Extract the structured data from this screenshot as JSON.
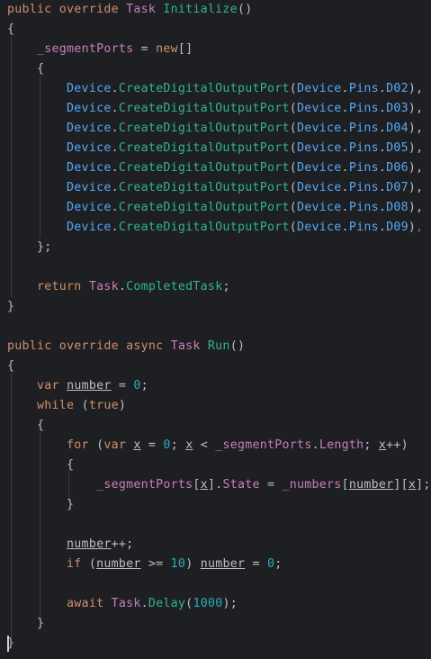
{
  "editor": {
    "lines": [
      [
        {
          "c": "k",
          "t": "public override "
        },
        {
          "c": "t",
          "t": "Task "
        },
        {
          "c": "grn",
          "t": "Initialize"
        },
        {
          "c": "p",
          "t": "()"
        }
      ],
      [
        {
          "c": "p",
          "t": "{"
        }
      ],
      [
        {
          "c": "p",
          "t": "    "
        },
        {
          "c": "f",
          "t": "_segmentPorts"
        },
        {
          "c": "p",
          "t": " = "
        },
        {
          "c": "k",
          "t": "new"
        },
        {
          "c": "p",
          "t": "[]"
        }
      ],
      [
        {
          "c": "p",
          "t": "    {"
        }
      ],
      [
        {
          "c": "p",
          "t": "        "
        },
        {
          "c": "dev",
          "t": "Device"
        },
        {
          "c": "p",
          "t": "."
        },
        {
          "c": "grn",
          "t": "CreateDigitalOutputPort"
        },
        {
          "c": "p",
          "t": "("
        },
        {
          "c": "dev",
          "t": "Device"
        },
        {
          "c": "p",
          "t": "."
        },
        {
          "c": "dev",
          "t": "Pins"
        },
        {
          "c": "p",
          "t": "."
        },
        {
          "c": "dev",
          "t": "D02"
        },
        {
          "c": "p",
          "t": "),"
        }
      ],
      [
        {
          "c": "p",
          "t": "        "
        },
        {
          "c": "dev",
          "t": "Device"
        },
        {
          "c": "p",
          "t": "."
        },
        {
          "c": "grn",
          "t": "CreateDigitalOutputPort"
        },
        {
          "c": "p",
          "t": "("
        },
        {
          "c": "dev",
          "t": "Device"
        },
        {
          "c": "p",
          "t": "."
        },
        {
          "c": "dev",
          "t": "Pins"
        },
        {
          "c": "p",
          "t": "."
        },
        {
          "c": "dev",
          "t": "D03"
        },
        {
          "c": "p",
          "t": "),"
        }
      ],
      [
        {
          "c": "p",
          "t": "        "
        },
        {
          "c": "dev",
          "t": "Device"
        },
        {
          "c": "p",
          "t": "."
        },
        {
          "c": "grn",
          "t": "CreateDigitalOutputPort"
        },
        {
          "c": "p",
          "t": "("
        },
        {
          "c": "dev",
          "t": "Device"
        },
        {
          "c": "p",
          "t": "."
        },
        {
          "c": "dev",
          "t": "Pins"
        },
        {
          "c": "p",
          "t": "."
        },
        {
          "c": "dev",
          "t": "D04"
        },
        {
          "c": "p",
          "t": "),"
        }
      ],
      [
        {
          "c": "p",
          "t": "        "
        },
        {
          "c": "dev",
          "t": "Device"
        },
        {
          "c": "p",
          "t": "."
        },
        {
          "c": "grn",
          "t": "CreateDigitalOutputPort"
        },
        {
          "c": "p",
          "t": "("
        },
        {
          "c": "dev",
          "t": "Device"
        },
        {
          "c": "p",
          "t": "."
        },
        {
          "c": "dev",
          "t": "Pins"
        },
        {
          "c": "p",
          "t": "."
        },
        {
          "c": "dev",
          "t": "D05"
        },
        {
          "c": "p",
          "t": "),"
        }
      ],
      [
        {
          "c": "p",
          "t": "        "
        },
        {
          "c": "dev",
          "t": "Device"
        },
        {
          "c": "p",
          "t": "."
        },
        {
          "c": "grn",
          "t": "CreateDigitalOutputPort"
        },
        {
          "c": "p",
          "t": "("
        },
        {
          "c": "dev",
          "t": "Device"
        },
        {
          "c": "p",
          "t": "."
        },
        {
          "c": "dev",
          "t": "Pins"
        },
        {
          "c": "p",
          "t": "."
        },
        {
          "c": "dev",
          "t": "D06"
        },
        {
          "c": "p",
          "t": "),"
        }
      ],
      [
        {
          "c": "p",
          "t": "        "
        },
        {
          "c": "dev",
          "t": "Device"
        },
        {
          "c": "p",
          "t": "."
        },
        {
          "c": "grn",
          "t": "CreateDigitalOutputPort"
        },
        {
          "c": "p",
          "t": "("
        },
        {
          "c": "dev",
          "t": "Device"
        },
        {
          "c": "p",
          "t": "."
        },
        {
          "c": "dev",
          "t": "Pins"
        },
        {
          "c": "p",
          "t": "."
        },
        {
          "c": "dev",
          "t": "D07"
        },
        {
          "c": "p",
          "t": "),"
        }
      ],
      [
        {
          "c": "p",
          "t": "        "
        },
        {
          "c": "dev",
          "t": "Device"
        },
        {
          "c": "p",
          "t": "."
        },
        {
          "c": "grn",
          "t": "CreateDigitalOutputPort"
        },
        {
          "c": "p",
          "t": "("
        },
        {
          "c": "dev",
          "t": "Device"
        },
        {
          "c": "p",
          "t": "."
        },
        {
          "c": "dev",
          "t": "Pins"
        },
        {
          "c": "p",
          "t": "."
        },
        {
          "c": "dev",
          "t": "D08"
        },
        {
          "c": "p",
          "t": "),"
        }
      ],
      [
        {
          "c": "p",
          "t": "        "
        },
        {
          "c": "dev",
          "t": "Device"
        },
        {
          "c": "p",
          "t": "."
        },
        {
          "c": "grn",
          "t": "CreateDigitalOutputPort"
        },
        {
          "c": "p",
          "t": "("
        },
        {
          "c": "dev",
          "t": "Device"
        },
        {
          "c": "p",
          "t": "."
        },
        {
          "c": "dev",
          "t": "Pins"
        },
        {
          "c": "p",
          "t": "."
        },
        {
          "c": "dev",
          "t": "D09"
        },
        {
          "c": "p",
          "t": ")"
        },
        {
          "c": "dim",
          "t": ","
        }
      ],
      [
        {
          "c": "p",
          "t": "    };"
        }
      ],
      [],
      [
        {
          "c": "p",
          "t": "    "
        },
        {
          "c": "k",
          "t": "return "
        },
        {
          "c": "t",
          "t": "Task"
        },
        {
          "c": "p",
          "t": "."
        },
        {
          "c": "grn",
          "t": "CompletedTask"
        },
        {
          "c": "p",
          "t": ";"
        }
      ],
      [
        {
          "c": "p",
          "t": "}"
        }
      ],
      [],
      [
        {
          "c": "k",
          "t": "public override async "
        },
        {
          "c": "t",
          "t": "Task "
        },
        {
          "c": "grn",
          "t": "Run"
        },
        {
          "c": "p",
          "t": "()"
        }
      ],
      [
        {
          "c": "p",
          "t": "{"
        }
      ],
      [
        {
          "c": "p",
          "t": "    "
        },
        {
          "c": "k",
          "t": "var "
        },
        {
          "c": "v",
          "t": "number"
        },
        {
          "c": "p",
          "t": " = "
        },
        {
          "c": "n",
          "t": "0"
        },
        {
          "c": "p",
          "t": ";"
        }
      ],
      [
        {
          "c": "p",
          "t": "    "
        },
        {
          "c": "k",
          "t": "while "
        },
        {
          "c": "p",
          "t": "("
        },
        {
          "c": "k",
          "t": "true"
        },
        {
          "c": "p",
          "t": ")"
        }
      ],
      [
        {
          "c": "p",
          "t": "    {"
        }
      ],
      [
        {
          "c": "p",
          "t": "        "
        },
        {
          "c": "k",
          "t": "for "
        },
        {
          "c": "p",
          "t": "("
        },
        {
          "c": "k",
          "t": "var "
        },
        {
          "c": "v",
          "t": "x"
        },
        {
          "c": "p",
          "t": " = "
        },
        {
          "c": "n",
          "t": "0"
        },
        {
          "c": "p",
          "t": "; "
        },
        {
          "c": "v",
          "t": "x"
        },
        {
          "c": "p",
          "t": " < "
        },
        {
          "c": "f",
          "t": "_segmentPorts"
        },
        {
          "c": "p",
          "t": "."
        },
        {
          "c": "pr",
          "t": "Length"
        },
        {
          "c": "p",
          "t": "; "
        },
        {
          "c": "v",
          "t": "x"
        },
        {
          "c": "p",
          "t": "++)"
        }
      ],
      [
        {
          "c": "p",
          "t": "        {"
        }
      ],
      [
        {
          "c": "p",
          "t": "            "
        },
        {
          "c": "f",
          "t": "_segmentPorts"
        },
        {
          "c": "p",
          "t": "["
        },
        {
          "c": "v",
          "t": "x"
        },
        {
          "c": "p",
          "t": "]."
        },
        {
          "c": "pr",
          "t": "State"
        },
        {
          "c": "p",
          "t": " = "
        },
        {
          "c": "f",
          "t": "_numbers"
        },
        {
          "c": "p",
          "t": "["
        },
        {
          "c": "v",
          "t": "number"
        },
        {
          "c": "p",
          "t": "]["
        },
        {
          "c": "v",
          "t": "x"
        },
        {
          "c": "p",
          "t": "];"
        }
      ],
      [
        {
          "c": "p",
          "t": "        }"
        }
      ],
      [],
      [
        {
          "c": "p",
          "t": "        "
        },
        {
          "c": "v",
          "t": "number"
        },
        {
          "c": "p",
          "t": "++;"
        }
      ],
      [
        {
          "c": "p",
          "t": "        "
        },
        {
          "c": "k",
          "t": "if "
        },
        {
          "c": "p",
          "t": "("
        },
        {
          "c": "v",
          "t": "number"
        },
        {
          "c": "p",
          "t": " >= "
        },
        {
          "c": "n",
          "t": "10"
        },
        {
          "c": "p",
          "t": ") "
        },
        {
          "c": "v",
          "t": "number"
        },
        {
          "c": "p",
          "t": " = "
        },
        {
          "c": "n",
          "t": "0"
        },
        {
          "c": "p",
          "t": ";"
        }
      ],
      [],
      [
        {
          "c": "p",
          "t": "        "
        },
        {
          "c": "k",
          "t": "await "
        },
        {
          "c": "t",
          "t": "Task"
        },
        {
          "c": "p",
          "t": "."
        },
        {
          "c": "grn",
          "t": "Delay"
        },
        {
          "c": "p",
          "t": "("
        },
        {
          "c": "n",
          "t": "1000"
        },
        {
          "c": "p",
          "t": ");"
        }
      ],
      [
        {
          "c": "p",
          "t": "    }"
        }
      ],
      [
        {
          "c": "p",
          "t": "}"
        }
      ]
    ]
  }
}
